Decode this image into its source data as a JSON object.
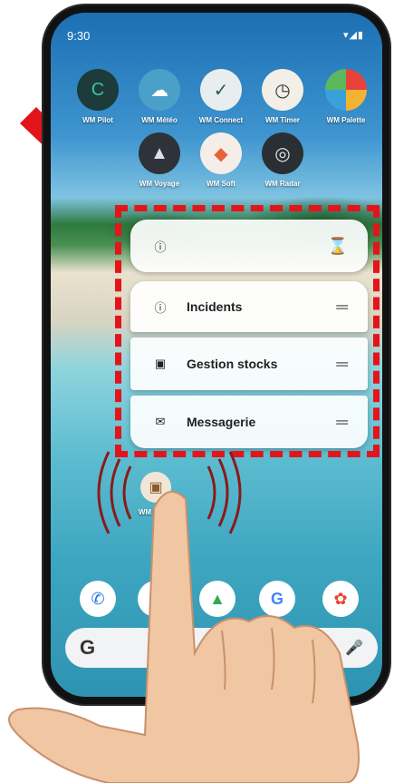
{
  "status": {
    "time": "9:30",
    "icons": "▾◢▮"
  },
  "apps": [
    {
      "label": "WM Pilot",
      "icon": "C",
      "color": "#1d3b3b"
    },
    {
      "label": "WM Météo",
      "icon": "☁",
      "color": "#4aa0c8"
    },
    {
      "label": "WM Connect",
      "icon": "✓",
      "color": "#2f5a52"
    },
    {
      "label": "WM Timer",
      "icon": "◷",
      "color": "#2b3a3a"
    },
    {
      "label": "WM Palette",
      "icon": "◑",
      "color": "#e26a3a"
    },
    {
      "label": "WM Voyage",
      "icon": "▲",
      "color": "#2d3338"
    },
    {
      "label": "WM Soft",
      "icon": "◆",
      "color": "#e6623a"
    },
    {
      "label": "WM Radar",
      "icon": "◎",
      "color": "#2a2f33"
    }
  ],
  "menu": {
    "info_icon": "ⓘ",
    "hourglass_icon": "⌛",
    "handle_icon": "═",
    "items": [
      {
        "label": "Incidents",
        "icon": "ⓘ"
      },
      {
        "label": "Gestion stocks",
        "icon": "▣"
      },
      {
        "label": "Messagerie",
        "icon": "✉"
      }
    ]
  },
  "held_app": {
    "label": "WM Stock"
  },
  "dock": [
    {
      "icon": "✆",
      "name": "phone"
    },
    {
      "icon": "✉",
      "name": "messages"
    },
    {
      "icon": "▲",
      "name": "drive"
    },
    {
      "icon": "G",
      "name": "news"
    },
    {
      "icon": "✿",
      "name": "photos"
    }
  ],
  "search": {
    "logo": "G",
    "mic": "🎤"
  },
  "colors": {
    "highlight": "#e3141b",
    "arrow": "#e3141b",
    "skin": "#f1c6a3"
  }
}
